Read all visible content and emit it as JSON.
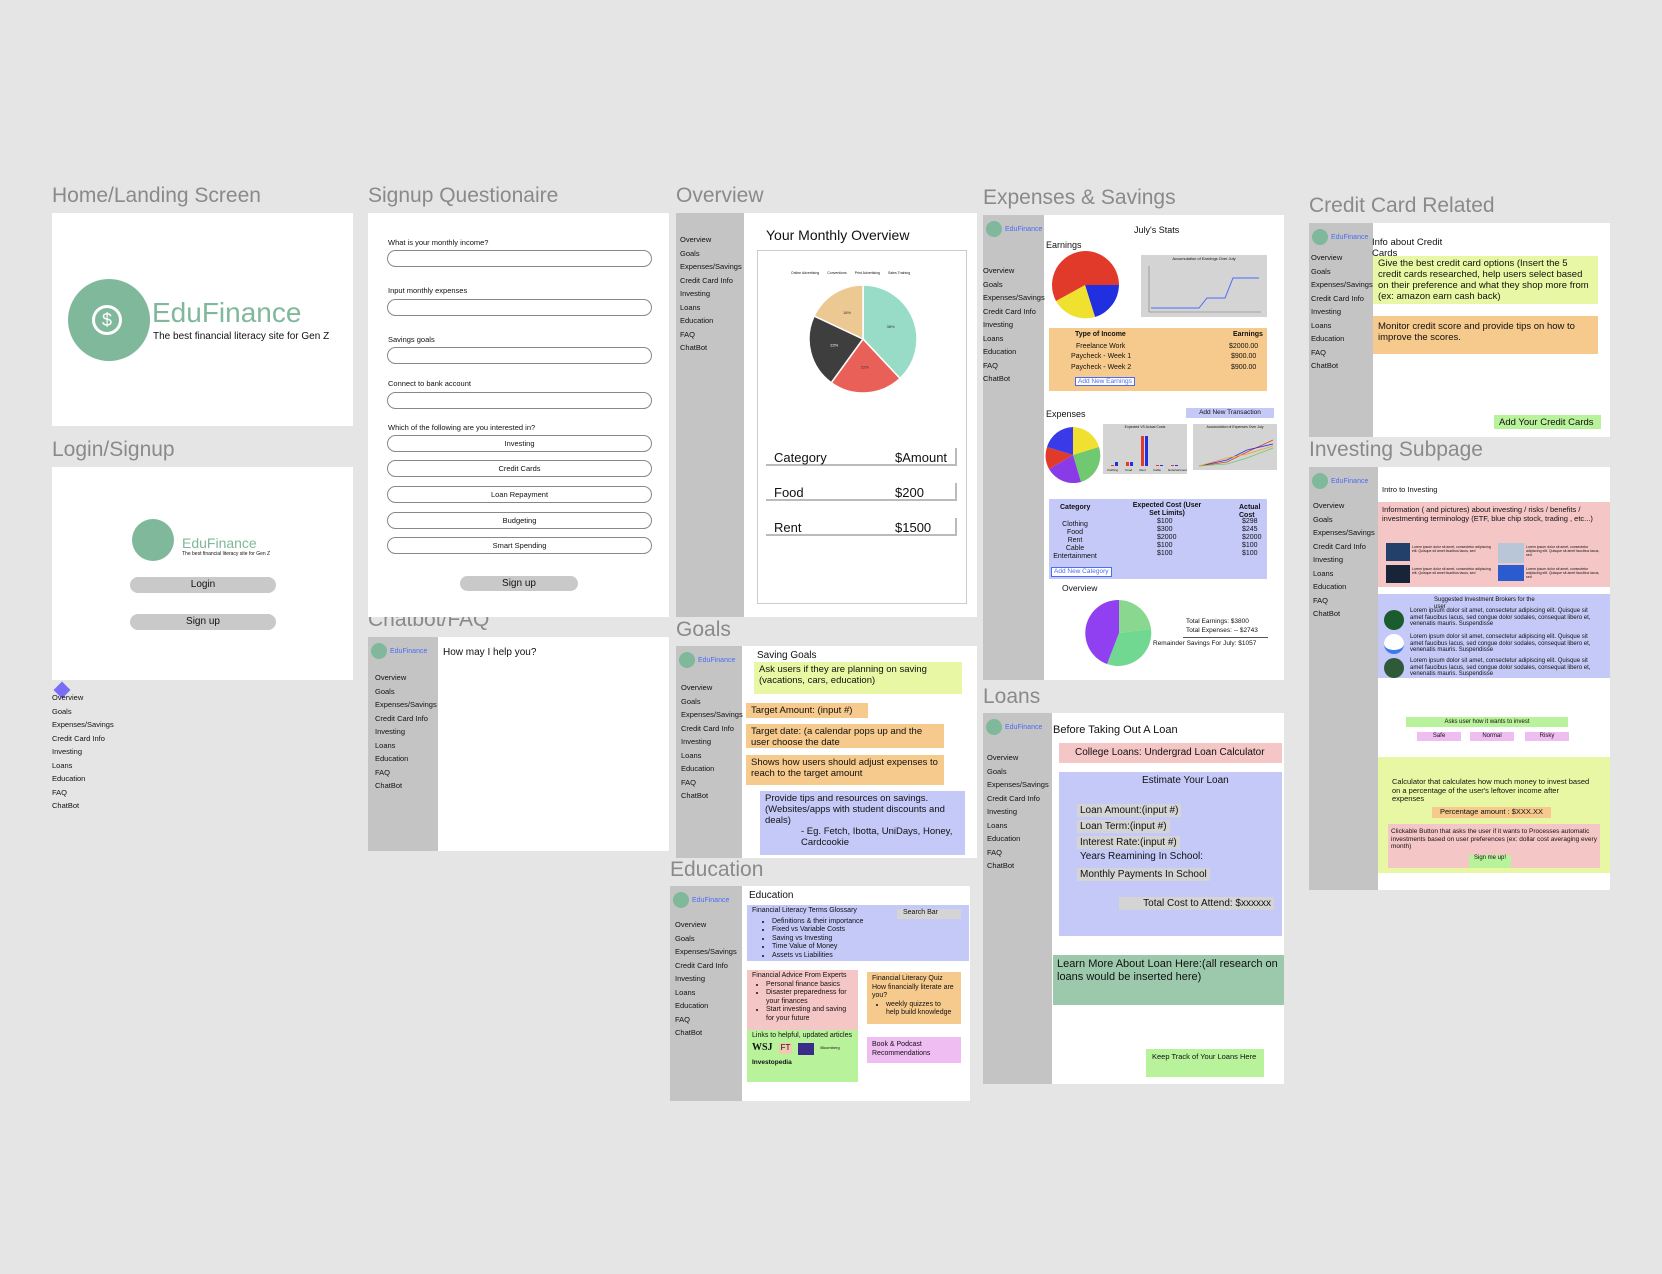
{
  "sections": {
    "home": "Home/Landing Screen",
    "signup": "Signup Questionaire",
    "overview": "Overview",
    "expenses": "Expenses & Savings",
    "credit": "Credit Card Related",
    "login": "Login/Signup",
    "chatbot": "Chatbot/FAQ",
    "goals": "Goals",
    "education": "Education",
    "loans": "Loans",
    "investing": "Investing Subpage"
  },
  "brand": {
    "name": "EduFinance",
    "tagline": "The best financial literacy site for Gen Z",
    "logo_color": "#7fb89a",
    "link_color": "#4a6cf7"
  },
  "nav": [
    "Overview",
    "Goals",
    "Expenses/Savings",
    "Credit Card Info",
    "Investing",
    "Loans",
    "Education",
    "FAQ",
    "ChatBot"
  ],
  "login": {
    "login": "Login",
    "signup": "Sign up"
  },
  "signup_form": {
    "q1": "What is your monthly income?",
    "q2": "Input monthly expenses",
    "q3": "Savings goals",
    "q4": "Connect to bank account",
    "q5": "Which of the following are you interested in?",
    "options": [
      "Investing",
      "Credit Cards",
      "Loan Repayment",
      "Budgeting",
      "Smart Spending"
    ],
    "submit": "Sign up"
  },
  "overview": {
    "title": "Your Monthly Overview",
    "legend": [
      "Online Advertising",
      "Conventions",
      "Print Advertising",
      "Sales Training"
    ],
    "slices": [
      {
        "value": 38,
        "label": "38%",
        "color": "#98dcc8"
      },
      {
        "value": 22,
        "label": "22%",
        "color": "#e86058"
      },
      {
        "value": 22,
        "label": "22%",
        "color": "#3e3e3e"
      },
      {
        "value": 18,
        "label": "18%",
        "color": "#ecc992"
      }
    ],
    "col1": "Category",
    "col2": "$Amount",
    "rows": [
      {
        "cat": "Food",
        "amt": "$200"
      },
      {
        "cat": "Rent",
        "amt": "$1500"
      }
    ]
  },
  "chatbot": {
    "prompt": "How may I help you?"
  },
  "goals": {
    "title": "Saving Goals",
    "n1": "Ask users if they are planning on saving (vacations, cars, education)",
    "n2": "Target Amount: (input #)",
    "n3": "Target date: (a calendar pops up and the user choose the date",
    "n4": "Shows how users should adjust expenses to reach to the target amount",
    "n5": "Provide tips and resources on savings. (Websites/apps with student discounts and deals)",
    "n6": "-  Eg. Fetch, Ibotta, UniDays, Honey, Cardcookie"
  },
  "education": {
    "title": "Education",
    "glossary": "Financial Literacy Terms Glossary",
    "search": "Search Bar",
    "terms": [
      "Definitions & their importance",
      "Fixed vs Variable Costs",
      "Saving vs Investing",
      "Time Value of Money",
      "Assets vs Liabilities"
    ],
    "advice_title": "Financial Advice From Experts",
    "advice": [
      "Personal finance basics",
      "Disaster preparedness for your finances",
      "Start investing and saving for your future"
    ],
    "quiz_title": "Financial Literacy Quiz",
    "quiz_q": "How financially literate are you?",
    "quiz_item": "weekly quizzes to help build knowledge",
    "links": "Links to helpful, updated articles",
    "pubs": [
      "WSJ",
      "FT",
      "Bloomberg",
      "Investopedia"
    ],
    "books": "Book & Podcast Recommendations"
  },
  "expenses": {
    "stats": "July's Stats",
    "earnings": "Earnings",
    "earn_chart": "Accumulation of Earnings Over July",
    "income_h1": "Type of Income",
    "income_h2": "Earnings",
    "income": [
      {
        "type": "Freelance Work",
        "amt": "$2000.00"
      },
      {
        "type": "Paycheck - Week 1",
        "amt": "$900.00"
      },
      {
        "type": "Paycheck - Week 2",
        "amt": "$900.00"
      }
    ],
    "add_earnings": "Add New Earnings",
    "expenses": "Expenses",
    "add_tx": "Add New Transaction",
    "bar_title": "Expected VS Actual Costs",
    "bar_cats": [
      "Clothing",
      "Food",
      "Rent",
      "Cable",
      "Entertainment"
    ],
    "line_title": "Accumulation of Expenses Over July",
    "tbl_h1": "Category",
    "tbl_h2": "Expected Cost (User Set Limits)",
    "tbl_h3": "Actual Cost",
    "tbl_cat": [
      "Clothing",
      "Food",
      "Rent",
      "Cable",
      "Entertainment"
    ],
    "tbl_exp": [
      "$100",
      "$300",
      "$2000",
      "$100",
      "$100"
    ],
    "tbl_act": [
      "$298",
      "$245",
      "$2000",
      "$100",
      "$100"
    ],
    "add_cat": "Add New Category",
    "overview": "Overview",
    "total_earn": "Total Earnings:    $3800",
    "total_exp": "Total Expenses:  -- $2743",
    "remainder": "Remainder Savings For July: $1057"
  },
  "loans": {
    "title": "Before Taking Out A Loan",
    "calc": "College Loans: Undergrad Loan Calculator",
    "estimate": "Estimate Your Loan",
    "f1": "Loan Amount:(input #)",
    "f2": "Loan Term:(input #)",
    "f3": "Interest Rate:(input #)",
    "f4": "Years Reamining In School:",
    "f5": "Monthly Payments In School",
    "total": "Total Cost to Attend: $xxxxxx",
    "learn": "Learn More About Loan Here:(all research on loans would be inserted here)",
    "track": "Keep Track of Your Loans Here"
  },
  "credit": {
    "title": "Info about Credit Cards",
    "n1": "Give the best credit card options (Insert the 5 credit cards researched, help users select based on their preference and what they shop more from (ex: amazon earn cash back)",
    "n2": "Monitor credit score and provide tips on how to improve the scores.",
    "add": "Add Your Credit Cards Here!"
  },
  "investing": {
    "intro": "Intro to Investing",
    "info": "Information ( and pictures) about investing / risks / benefits / investmenting terminology (ETF, blue chip stock, trading , etc...)",
    "lorem": "Lorem ipsum dolor sit amet, consectetur adipiscing elit. Quisque sit amet faucibus lacus, sed",
    "brokers": "Suggested Investment Brokers for the user",
    "broker_text": "Lorem ipsum dolor sit amet, consectetur adipiscing elit. Quisque sit amet faucibus lacus, sed congue dolor sodales, consequat libero et, venenatis mauris. Suspendisse",
    "risk_q": "Asks user how it wants to invest",
    "risks": [
      "Safe",
      "Normal",
      "Risky"
    ],
    "calc": "Calculator that calculates how much money to invest based on a percentage of the user's leftover income after expenses",
    "pct": "Percentage amount : $XXX.XX",
    "auto": "Clickable Button that asks the user if it wants to Processes automatic investments based on user preferences (ex: dollar cost averaging every month)",
    "signme": "Sign me up!"
  }
}
